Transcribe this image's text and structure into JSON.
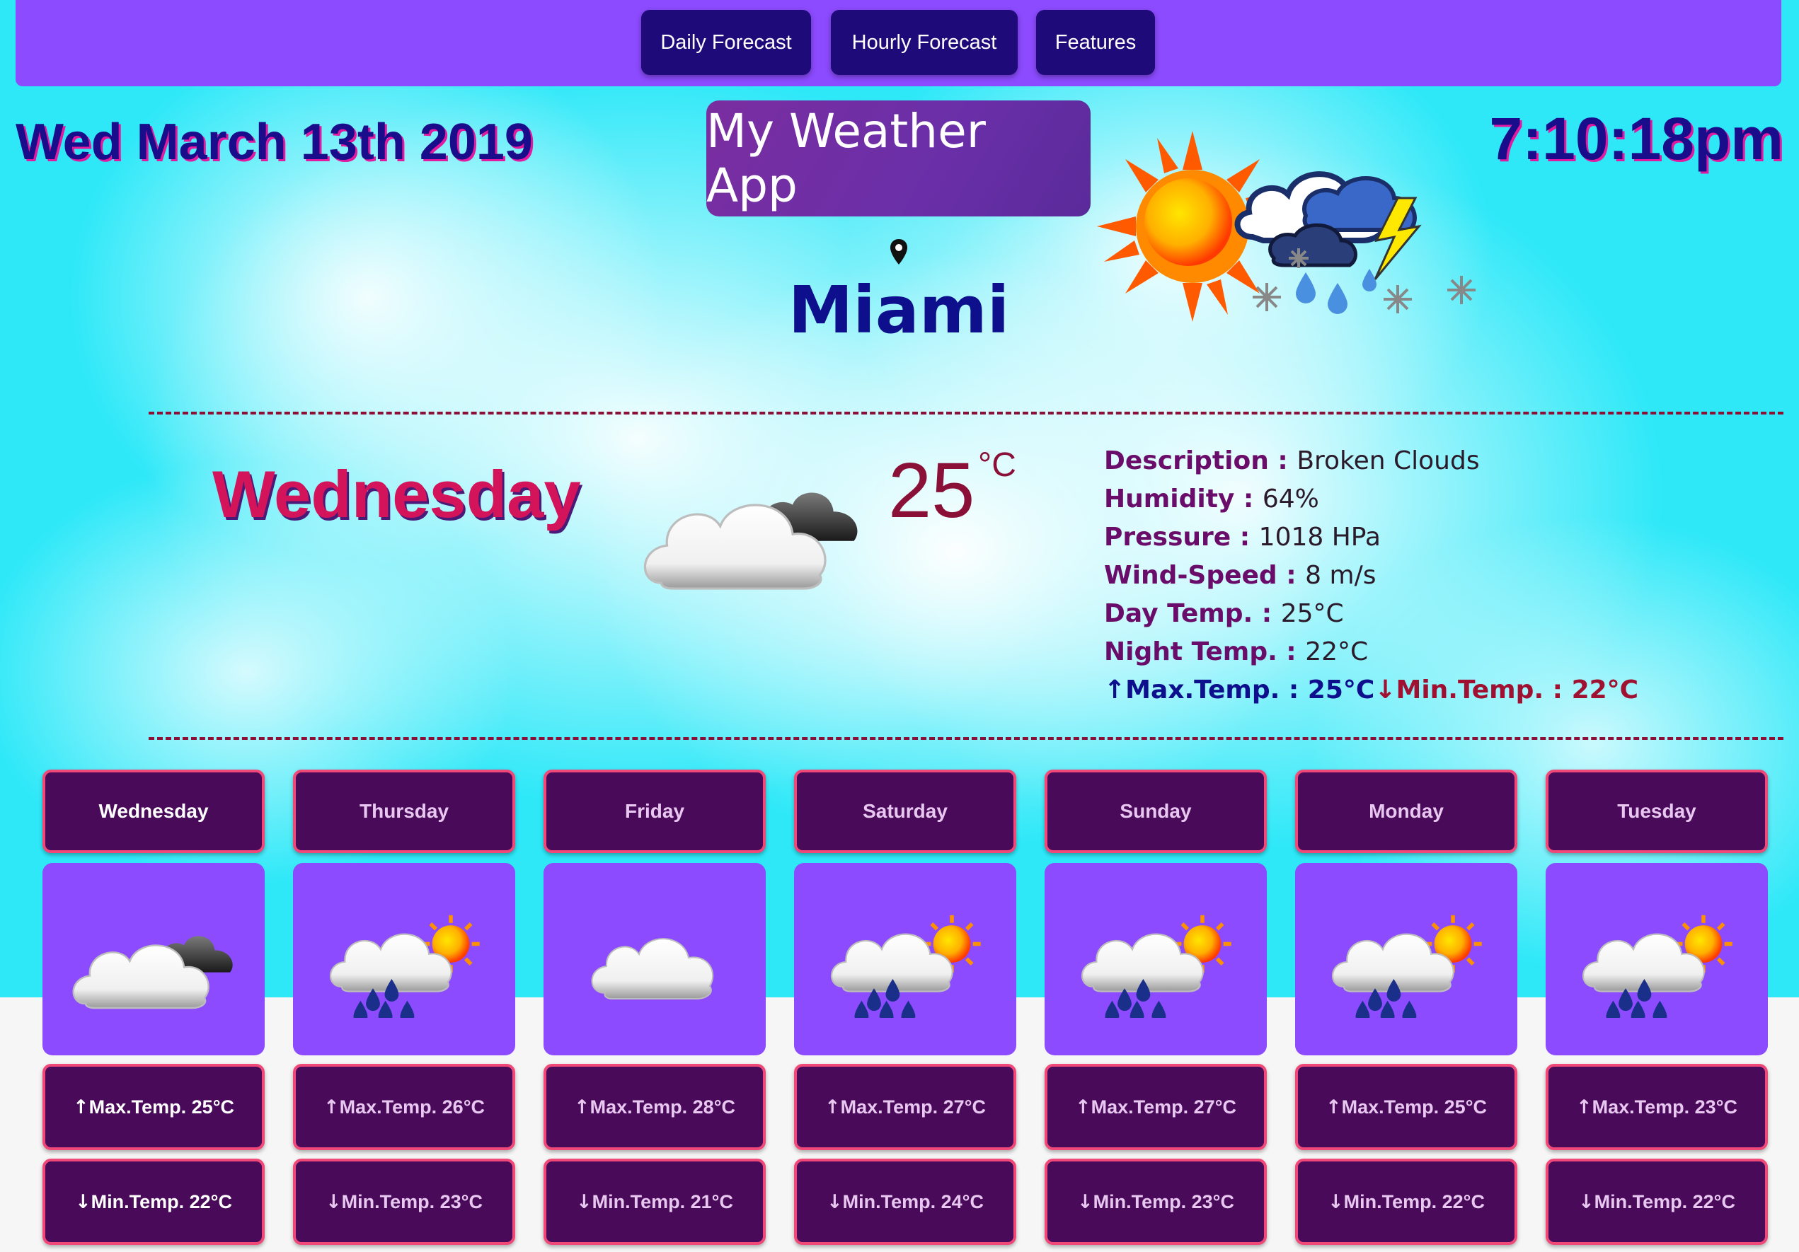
{
  "nav": {
    "daily": "Daily Forecast",
    "hourly": "Hourly Forecast",
    "features": "Features"
  },
  "header": {
    "date": "Wed March 13th 2019",
    "time": "7:10:18pm",
    "app_title": "My Weather App",
    "city": "Miami"
  },
  "today": {
    "day": "Wednesday",
    "temp": "25",
    "unit": "°C",
    "details": [
      {
        "label": "Description : ",
        "value": "Broken Clouds"
      },
      {
        "label": "Humidity : ",
        "value": "64%"
      },
      {
        "label": "Pressure : ",
        "value": "1018 HPa"
      },
      {
        "label": "Wind-Speed : ",
        "value": "8 m/s"
      },
      {
        "label": "Day Temp. : ",
        "value": "25°C"
      },
      {
        "label": "Night Temp. : ",
        "value": "22°C"
      }
    ],
    "max": "Max.Temp. : 25°C",
    "min": "Min.Temp. : 22°C"
  },
  "forecast": [
    {
      "day": "Wednesday",
      "icon": "broken-clouds-icon",
      "max": "Max.Temp. 25°C",
      "min": "Min.Temp. 22°C"
    },
    {
      "day": "Thursday",
      "icon": "rain-sun-icon",
      "max": "Max.Temp. 26°C",
      "min": "Min.Temp. 23°C"
    },
    {
      "day": "Friday",
      "icon": "cloud-icon",
      "max": "Max.Temp. 28°C",
      "min": "Min.Temp. 21°C"
    },
    {
      "day": "Saturday",
      "icon": "rain-sun-icon",
      "max": "Max.Temp. 27°C",
      "min": "Min.Temp. 24°C"
    },
    {
      "day": "Sunday",
      "icon": "rain-sun-icon",
      "max": "Max.Temp. 27°C",
      "min": "Min.Temp. 23°C"
    },
    {
      "day": "Monday",
      "icon": "rain-sun-icon",
      "max": "Max.Temp. 25°C",
      "min": "Min.Temp. 22°C"
    },
    {
      "day": "Tuesday",
      "icon": "rain-sun-icon",
      "max": "Max.Temp. 23°C",
      "min": "Min.Temp. 22°C"
    }
  ],
  "colors": {
    "navbar": "#8c4bff",
    "nav_button": "#1e0a78",
    "sky": "#2ee8f8",
    "day_tile": "#4a0a5a",
    "tile_border": "#f04878",
    "accent_day": "#d4145a",
    "heading_blue": "#1a0d8c"
  }
}
